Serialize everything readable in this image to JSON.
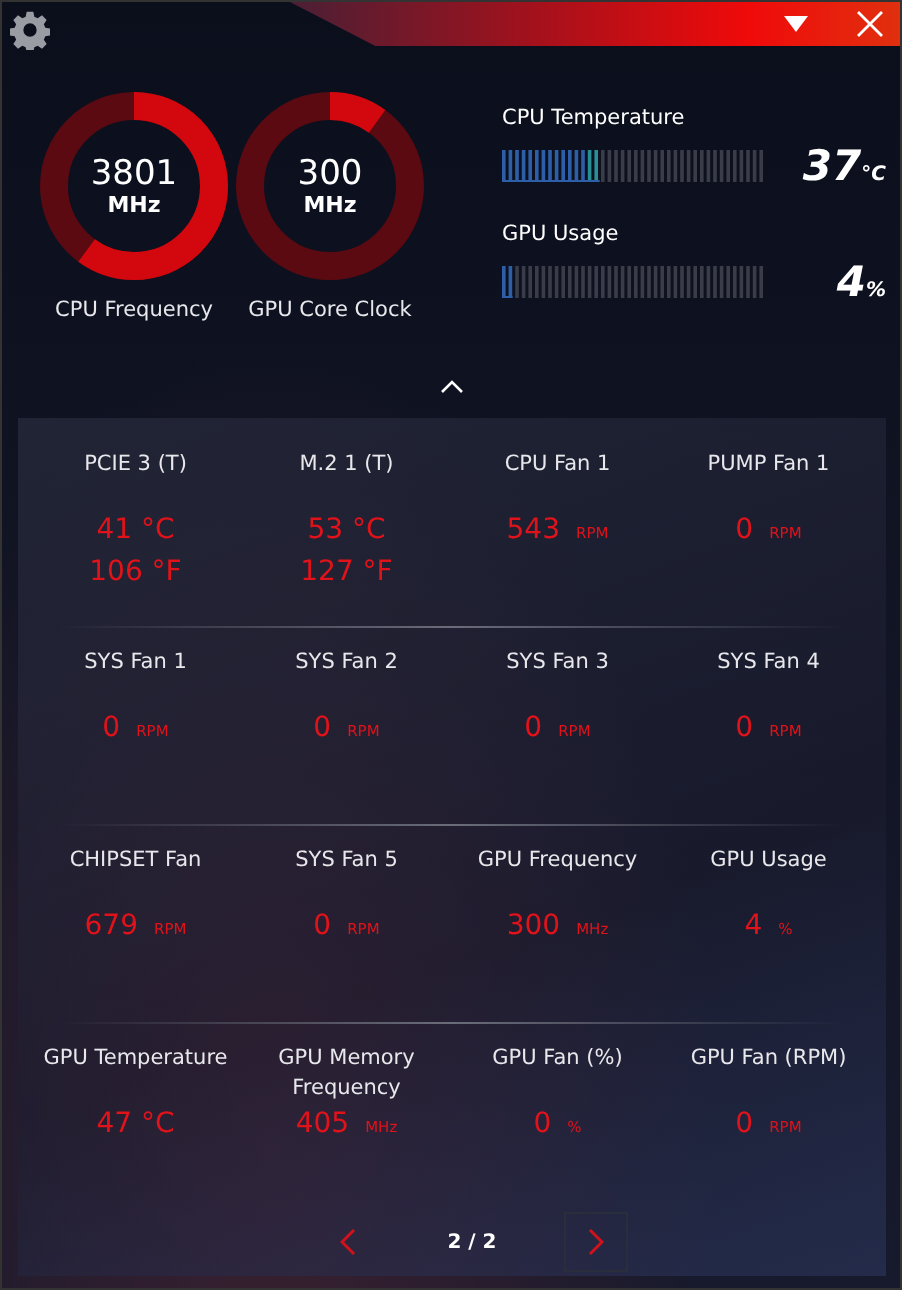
{
  "gauges": [
    {
      "value": "3801",
      "unit": "MHz",
      "label": "CPU Frequency",
      "level": 0.6
    },
    {
      "value": "300",
      "unit": "MHz",
      "label": "GPU Core Clock",
      "level": 0.1
    }
  ],
  "meters": [
    {
      "label": "CPU Temperature",
      "level": 0.37,
      "value": "37",
      "unit": "°C"
    },
    {
      "label": "GPU Usage",
      "level": 0.04,
      "value": "4",
      "unit": "%"
    }
  ],
  "sensors": [
    [
      {
        "label": "PCIE 3 (T)",
        "kind": "dual",
        "lines": [
          "41 °C",
          "106 °F"
        ]
      },
      {
        "label": "M.2 1 (T)",
        "kind": "dual",
        "lines": [
          "53 °C",
          "127 °F"
        ]
      },
      {
        "label": "CPU Fan 1",
        "kind": "unit",
        "value": "543",
        "unit": "RPM"
      },
      {
        "label": "PUMP Fan 1",
        "kind": "unit",
        "value": "0",
        "unit": "RPM"
      }
    ],
    [
      {
        "label": "SYS Fan 1",
        "kind": "unit",
        "value": "0",
        "unit": "RPM"
      },
      {
        "label": "SYS Fan 2",
        "kind": "unit",
        "value": "0",
        "unit": "RPM"
      },
      {
        "label": "SYS Fan 3",
        "kind": "unit",
        "value": "0",
        "unit": "RPM"
      },
      {
        "label": "SYS Fan 4",
        "kind": "unit",
        "value": "0",
        "unit": "RPM"
      }
    ],
    [
      {
        "label": "CHIPSET Fan",
        "kind": "unit",
        "value": "679",
        "unit": "RPM"
      },
      {
        "label": "SYS Fan 5",
        "kind": "unit",
        "value": "0",
        "unit": "RPM"
      },
      {
        "label": "GPU Frequency",
        "kind": "unit",
        "value": "300",
        "unit": "MHz"
      },
      {
        "label": "GPU Usage",
        "kind": "unit",
        "value": "4",
        "unit": "%"
      }
    ],
    [
      {
        "label": "GPU Temperature",
        "kind": "dual",
        "lines": [
          "47 °C"
        ]
      },
      {
        "label": "GPU Memory Frequency",
        "kind": "unit",
        "value": "405",
        "unit": "MHz"
      },
      {
        "label": "GPU Fan (%)",
        "kind": "unit",
        "value": "0",
        "unit": "%"
      },
      {
        "label": "GPU Fan (RPM)",
        "kind": "unit",
        "value": "0",
        "unit": "RPM"
      }
    ]
  ],
  "pager": "2 / 2"
}
